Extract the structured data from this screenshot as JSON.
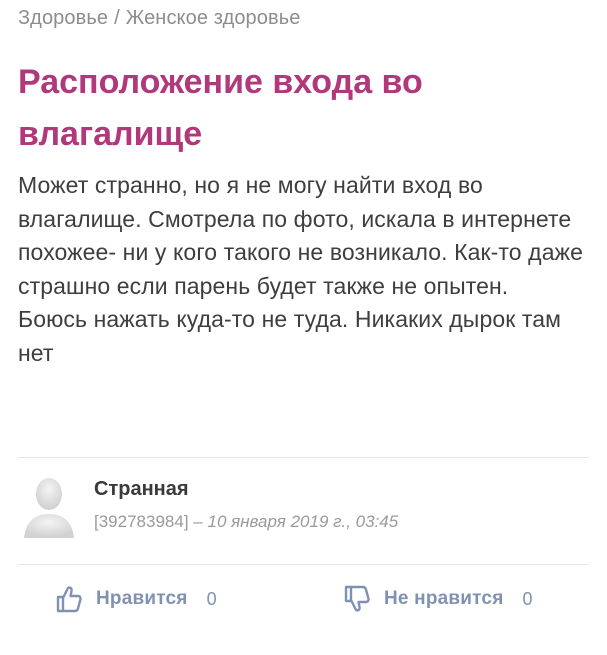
{
  "breadcrumb": {
    "items": [
      "Здоровье",
      "Женское здоровье"
    ],
    "separator": "/"
  },
  "post": {
    "title": "Расположение входа во влагалище",
    "body": "Может странно, но я не могу найти вход во влагалище. Смотрела по фото, искала в интернете похожее- ни у кого такого не возникало. Как-то даже страшно если парень будет также не опытен. Боюсь нажать куда-то не туда. Никаких дырок там нет"
  },
  "author": {
    "name": "Странная",
    "id": "[392783984]",
    "dash": "–",
    "date": "10 января 2019 г., 03:45"
  },
  "actions": {
    "like_label": "Нравится",
    "like_count": "0",
    "dislike_label": "Не нравится",
    "dislike_count": "0"
  },
  "colors": {
    "title": "#b1387b",
    "action": "#7f92b3",
    "muted": "#8d8d8d"
  },
  "icons": {
    "like": "thumbs-up-icon",
    "dislike": "thumbs-down-icon",
    "avatar": "user-silhouette"
  }
}
